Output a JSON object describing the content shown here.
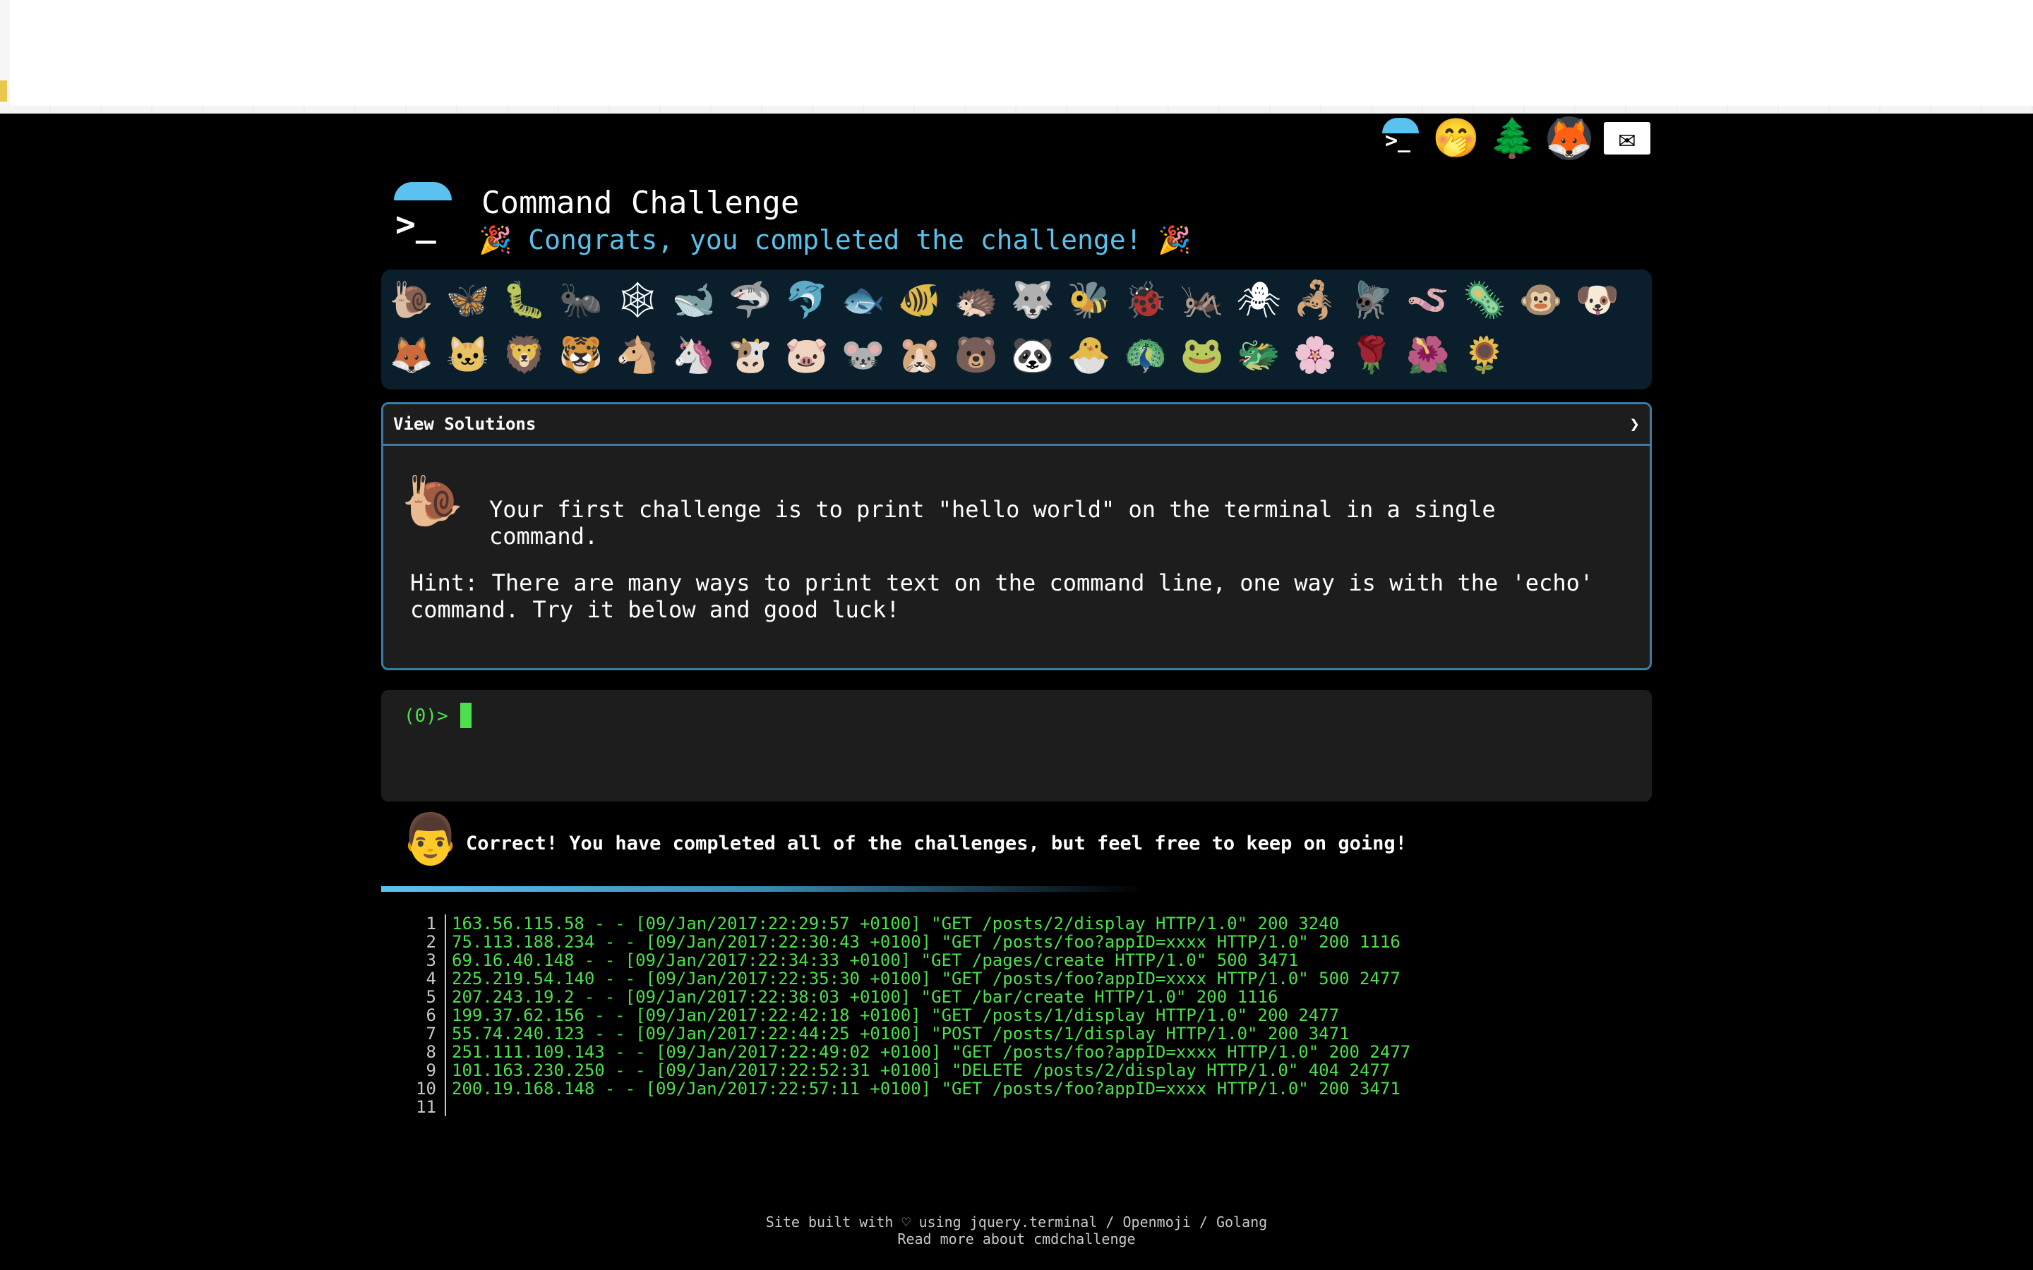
{
  "header": {
    "title": "Command Challenge",
    "subtitle": "🎉 Congrats, you completed the challenge! 🎉"
  },
  "top_icons": [
    {
      "name": "terminal-icon",
      "glyph": ">_"
    },
    {
      "name": "shushing-face-icon",
      "glyph": "🤭"
    },
    {
      "name": "tree-icon",
      "glyph": "🌲"
    },
    {
      "name": "gitlab-icon",
      "glyph": "🦊"
    },
    {
      "name": "mail-icon",
      "glyph": "✉"
    }
  ],
  "badges": [
    "🐌",
    "🦋",
    "🐛",
    "🐜",
    "🕸",
    "🐋",
    "🦈",
    "🐬",
    "🐟",
    "🐠",
    "🦔",
    "🐺",
    "🐝",
    "🐞",
    "🦗",
    "🕷",
    "🦂",
    "🪰",
    "🪱",
    "🦠",
    "🐵",
    "🐶",
    "🦊",
    "🐱",
    "🦁",
    "🐯",
    "🐴",
    "🦄",
    "🐮",
    "🐷",
    "🐭",
    "🐹",
    "🐻",
    "🐼",
    "🐣",
    "🦚",
    "🐸",
    "🐲",
    "🌸",
    "🌹",
    "🌺",
    "🌻"
  ],
  "challenge": {
    "solutions_label": "View Solutions",
    "solutions_chevron": "❯",
    "icon": "🐌",
    "task": "Your first challenge is to print \"hello world\" on the terminal in a single command.",
    "hint": "Hint: There are many ways to print text on the command line, one way is with the 'echo' command. Try it below and good luck!"
  },
  "terminal": {
    "prompt": "(0)>"
  },
  "result": {
    "avatar": "👨",
    "message": "Correct! You have completed all of the challenges, but feel free to keep on going!"
  },
  "log": {
    "lines": [
      {
        "n": "1",
        "text": "163.56.115.58 - - [09/Jan/2017:22:29:57 +0100] \"GET /posts/2/display HTTP/1.0\" 200 3240"
      },
      {
        "n": "2",
        "text": "75.113.188.234 - - [09/Jan/2017:22:30:43 +0100] \"GET /posts/foo?appID=xxxx HTTP/1.0\" 200 1116"
      },
      {
        "n": "3",
        "text": "69.16.40.148 - - [09/Jan/2017:22:34:33 +0100] \"GET /pages/create HTTP/1.0\" 500 3471"
      },
      {
        "n": "4",
        "text": "225.219.54.140 - - [09/Jan/2017:22:35:30 +0100] \"GET /posts/foo?appID=xxxx HTTP/1.0\" 500 2477"
      },
      {
        "n": "5",
        "text": "207.243.19.2 - - [09/Jan/2017:22:38:03 +0100] \"GET /bar/create HTTP/1.0\" 200 1116"
      },
      {
        "n": "6",
        "text": "199.37.62.156 - - [09/Jan/2017:22:42:18 +0100] \"GET /posts/1/display HTTP/1.0\" 200 2477"
      },
      {
        "n": "7",
        "text": "55.74.240.123 - - [09/Jan/2017:22:44:25 +0100] \"POST /posts/1/display HTTP/1.0\" 200 3471"
      },
      {
        "n": "8",
        "text": "251.111.109.143 - - [09/Jan/2017:22:49:02 +0100] \"GET /posts/foo?appID=xxxx HTTP/1.0\" 200 2477"
      },
      {
        "n": "9",
        "text": "101.163.230.250 - - [09/Jan/2017:22:52:31 +0100] \"DELETE /posts/2/display HTTP/1.0\" 404 2477"
      },
      {
        "n": "10",
        "text": "200.19.168.148 - - [09/Jan/2017:22:57:11 +0100] \"GET /posts/foo?appID=xxxx HTTP/1.0\" 200 3471"
      },
      {
        "n": "11",
        "text": ""
      }
    ]
  },
  "footer": {
    "line1": "Site built with ♡ using jquery.terminal / Openmoji / Golang",
    "line2": "Read more about cmdchallenge"
  },
  "colors": {
    "background": "#000000",
    "accent": "#5bc2f0",
    "terminal_green": "#4ce04c",
    "panel": "#1d1d1d",
    "border": "#3b7aa3"
  }
}
